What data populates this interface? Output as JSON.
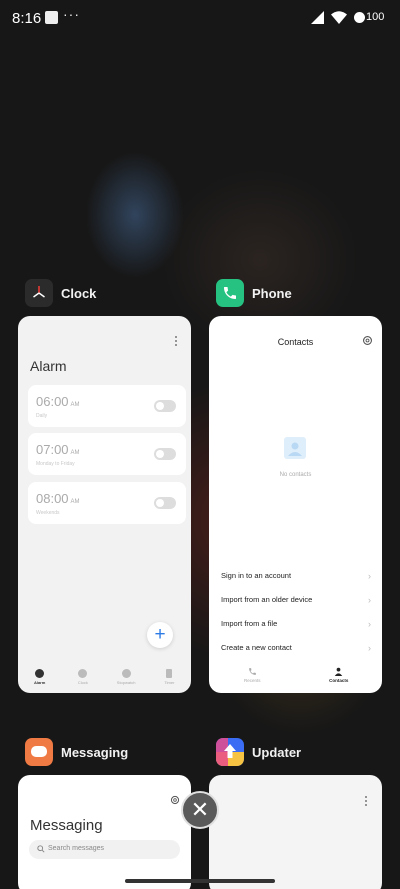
{
  "status_bar": {
    "time": "8:16",
    "more": "···",
    "battery": "100"
  },
  "apps": {
    "clock": {
      "name": "Clock",
      "title": "Alarm",
      "alarms": [
        {
          "time": "06:00",
          "ampm": "AM",
          "sub": "Daily",
          "enabled": false
        },
        {
          "time": "07:00",
          "ampm": "AM",
          "sub": "Monday to Friday",
          "enabled": false
        },
        {
          "time": "08:00",
          "ampm": "AM",
          "sub": "Weekends",
          "enabled": false
        }
      ],
      "add_label": "+",
      "tabs": [
        "Alarm",
        "Clock",
        "Stopwatch",
        "Timer"
      ]
    },
    "phone": {
      "name": "Phone",
      "header": "Contacts",
      "empty_text": "No contacts",
      "actions": [
        "Sign in to an account",
        "Import from an older device",
        "Import from a file",
        "Create a new contact"
      ],
      "chevron": "›",
      "tabs": [
        "Recents",
        "Contacts"
      ]
    },
    "messaging": {
      "name": "Messaging",
      "title": "Messaging",
      "search_placeholder": "Search messages"
    },
    "updater": {
      "name": "Updater"
    }
  },
  "close_all_label": "✕",
  "colors": {
    "phone_icon": "#26c281",
    "messaging_icon": "#f07a43",
    "updater_icon": "#3a6cf4",
    "clock_icon": "#2b2b2b",
    "fab_plus": "#2c7be5"
  }
}
